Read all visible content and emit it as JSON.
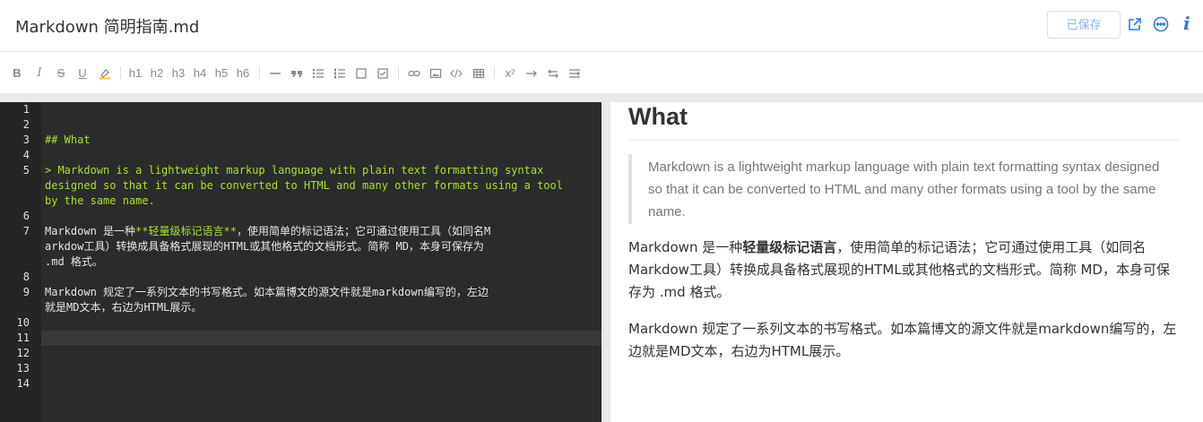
{
  "header": {
    "title": "Markdown 简明指南.md",
    "saved_label": "已保存",
    "icons": [
      "export-icon",
      "more-icon",
      "info-icon"
    ],
    "info_glyph": "i",
    "accent_color": "#2d7be8"
  },
  "toolbar": {
    "bold": "B",
    "italic": "I",
    "strike": "S",
    "underline": "U",
    "h1": "h1",
    "h2": "h2",
    "h3": "h3",
    "h4": "h4",
    "h5": "h5",
    "h6": "h6",
    "superscript": "x²"
  },
  "editor": {
    "line_numbers": [
      "1",
      "2",
      "3",
      "4",
      "5",
      "6",
      "7",
      "8",
      "9",
      "10",
      "11",
      "12",
      "13",
      "14"
    ],
    "line3": "## What",
    "line5_a": "> Markdown is a lightweight markup language with plain text formatting syntax",
    "line5_b": "designed so that it can be converted to HTML and many other formats using a tool",
    "line5_c": "by the same name.",
    "line7_pre": "Markdown 是一种",
    "line7_strong": "**轻量级标记语言**",
    "line7_post": "，使用简单的标记语法；它可通过使用工具（如同名M",
    "line7_b": "arkdow工具）转换成具备格式展现的HTML或其他格式的文档形式。简称 MD，本身可保存为",
    "line7_c": ".md 格式。",
    "line9_a": "Markdown 规定了一系列文本的书写格式。如本篇博文的源文件就是markdown编写的，左边",
    "line9_b": "就是MD文本，右边为HTML展示。"
  },
  "preview": {
    "heading": "What",
    "quote": "Markdown is a lightweight markup language with plain text formatting syntax designed so that it can be converted to HTML and many other formats using a tool by the same name.",
    "p1_pre": "Markdown 是一种",
    "p1_strong": "轻量级标记语言",
    "p1_post": "，使用简单的标记语法；它可通过使用工具（如同名Markdow工具）转换成具备格式展现的HTML或其他格式的文档形式。简称 MD，本身可保存为 .md 格式。",
    "p2": "Markdown 规定了一系列文本的书写格式。如本篇博文的源文件就是markdown编写的，左边就是MD文本，右边为HTML展示。"
  }
}
